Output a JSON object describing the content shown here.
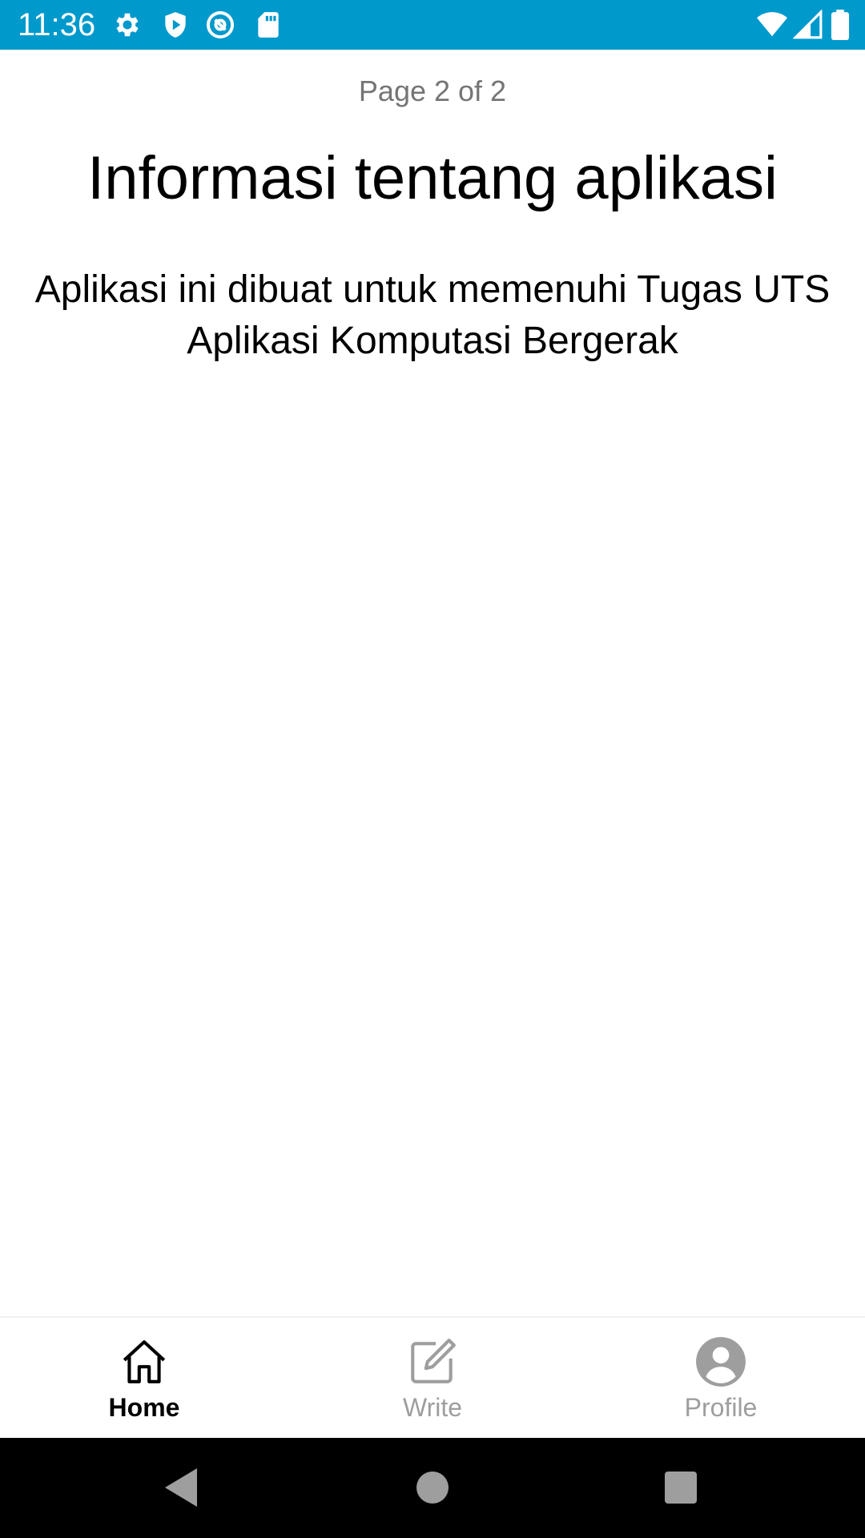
{
  "status_bar": {
    "time": "11:36",
    "left_icons": [
      "gear-icon",
      "shield-play-icon",
      "at-sign-icon",
      "sd-card-icon"
    ],
    "right_icons": [
      "wifi-icon",
      "signal-icon",
      "battery-icon"
    ],
    "background_color": "#0099CC"
  },
  "main": {
    "page_indicator": "Page 2 of 2",
    "title": "Informasi tentang aplikasi",
    "description": "Aplikasi ini dibuat untuk memenuhi Tugas UTS Aplikasi Komputasi Bergerak"
  },
  "bottom_nav": {
    "items": [
      {
        "label": "Home",
        "icon": "home-icon",
        "active": true
      },
      {
        "label": "Write",
        "icon": "edit-icon",
        "active": false
      },
      {
        "label": "Profile",
        "icon": "profile-icon",
        "active": false
      }
    ],
    "active_color": "#000000",
    "inactive_color": "#9e9e9e"
  },
  "system_nav": {
    "buttons": [
      "back-icon",
      "home-circle-icon",
      "recents-icon"
    ]
  }
}
